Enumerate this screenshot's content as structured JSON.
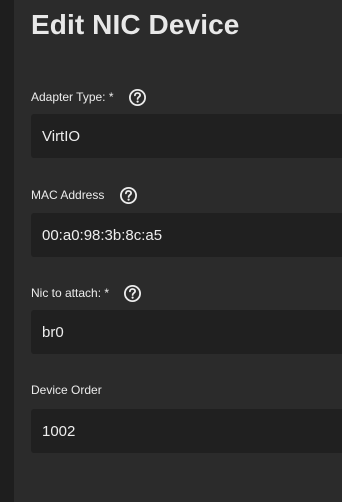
{
  "dialog": {
    "title": "Edit NIC Device"
  },
  "fields": {
    "adapter_type": {
      "label": "Adapter Type: *",
      "value": "VirtIO",
      "help_icon": "help-circle-icon"
    },
    "mac_address": {
      "label": "MAC Address",
      "value": "00:a0:98:3b:8c:a5",
      "help_icon": "help-circle-icon"
    },
    "nic_to_attach": {
      "label": "Nic to attach: *",
      "value": "br0",
      "help_icon": "help-circle-icon"
    },
    "device_order": {
      "label": "Device Order",
      "value": "1002"
    }
  },
  "colors": {
    "background": "#2b2b2b",
    "field_background": "#202020",
    "text": "#ececec"
  }
}
